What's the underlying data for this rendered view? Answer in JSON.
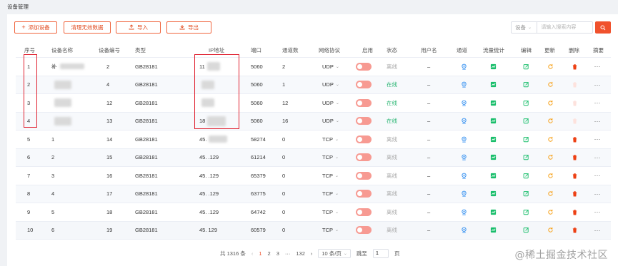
{
  "page": {
    "title": "设备管理"
  },
  "toolbar": {
    "add_label": "添加设备",
    "clear_label": "清理无效数据",
    "import_label": "导入",
    "export_label": "导出"
  },
  "search": {
    "type_value": "设备",
    "placeholder": "请输入搜索内容"
  },
  "table": {
    "headers": [
      "序号",
      "设备名称",
      "设备编号",
      "类型",
      "IP地址",
      "端口",
      "通道数",
      "网络协议",
      "启用",
      "状态",
      "用户名",
      "通道",
      "流量统计",
      "编辑",
      "更新",
      "删除",
      "摘要"
    ],
    "rows": [
      {
        "idx": "1",
        "name": "补",
        "code": "2",
        "type": "GB28181",
        "ip": "11",
        "port": "5060",
        "channels": "2",
        "protocol": "UDP",
        "status": "离线",
        "user": "–"
      },
      {
        "idx": "2",
        "name": "",
        "code": "4",
        "type": "GB28181",
        "ip": "",
        "port": "5060",
        "channels": "1",
        "protocol": "UDP",
        "status": "在线",
        "user": "–"
      },
      {
        "idx": "3",
        "name": "",
        "code": "12",
        "type": "GB28181",
        "ip": "",
        "port": "5060",
        "channels": "12",
        "protocol": "UDP",
        "status": "在线",
        "user": "–"
      },
      {
        "idx": "4",
        "name": "",
        "code": "13",
        "type": "GB28181",
        "ip": "18",
        "port": "5060",
        "channels": "16",
        "protocol": "UDP",
        "status": "在线",
        "user": "–"
      },
      {
        "idx": "5",
        "name": "1",
        "code": "14",
        "type": "GB28181",
        "ip": "45.",
        "port": "58274",
        "channels": "0",
        "protocol": "TCP",
        "status": "离线",
        "user": "–"
      },
      {
        "idx": "6",
        "name": "2",
        "code": "15",
        "type": "GB28181",
        "ip": "45.  .129",
        "port": "61214",
        "channels": "0",
        "protocol": "TCP",
        "status": "离线",
        "user": "–"
      },
      {
        "idx": "7",
        "name": "3",
        "code": "16",
        "type": "GB28181",
        "ip": "45.  .129",
        "port": "65379",
        "channels": "0",
        "protocol": "TCP",
        "status": "离线",
        "user": "–"
      },
      {
        "idx": "8",
        "name": "4",
        "code": "17",
        "type": "GB28181",
        "ip": "45.  .129",
        "port": "63775",
        "channels": "0",
        "protocol": "TCP",
        "status": "离线",
        "user": "–"
      },
      {
        "idx": "9",
        "name": "5",
        "code": "18",
        "type": "GB28181",
        "ip": "45.  .129",
        "port": "64742",
        "channels": "0",
        "protocol": "TCP",
        "status": "离线",
        "user": "–"
      },
      {
        "idx": "10",
        "name": "6",
        "code": "19",
        "type": "GB28181",
        "ip": "45.   129",
        "port": "60579",
        "channels": "0",
        "protocol": "TCP",
        "status": "离线",
        "user": "–"
      }
    ]
  },
  "pagination": {
    "total": "共 1316 条",
    "pages": [
      "1",
      "2",
      "3",
      "···",
      "132"
    ],
    "page_size": "10 条/页",
    "jump_label": "跳至",
    "jump_value": "1",
    "page_suffix": "页"
  },
  "watermark": "@稀土掘金技术社区",
  "colors": {
    "accent": "#f0522d",
    "online": "#2bb673",
    "toggle": "#f79a92",
    "link_blue": "#2d8cf0",
    "stats_green": "#19be6b"
  }
}
